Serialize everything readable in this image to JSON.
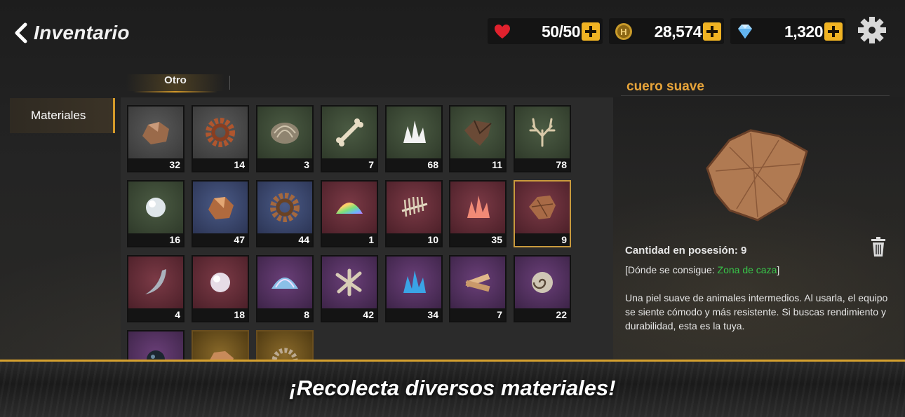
{
  "header": {
    "title": "Inventario",
    "resources": [
      {
        "name": "heart",
        "value": "50/50",
        "icon": "heart-icon"
      },
      {
        "name": "gold",
        "value": "28,574",
        "icon": "coin-icon"
      },
      {
        "name": "gems",
        "value": "1,320",
        "icon": "diamond-icon"
      }
    ]
  },
  "tabs": {
    "active": "Otro"
  },
  "sidebar": {
    "category": "Materiales"
  },
  "grid": {
    "items": [
      {
        "count": "32"
      },
      {
        "count": "14"
      },
      {
        "count": "3"
      },
      {
        "count": "7"
      },
      {
        "count": "68"
      },
      {
        "count": "11"
      },
      {
        "count": "78"
      },
      {
        "count": "16"
      },
      {
        "count": "47"
      },
      {
        "count": "44"
      },
      {
        "count": "1"
      },
      {
        "count": "10"
      },
      {
        "count": "35"
      },
      {
        "count": "9"
      },
      {
        "count": "4"
      },
      {
        "count": "18"
      },
      {
        "count": "8"
      },
      {
        "count": "42"
      },
      {
        "count": "34"
      },
      {
        "count": "7"
      },
      {
        "count": "22"
      },
      {
        "count": ""
      },
      {
        "count": ""
      },
      {
        "count": ""
      }
    ]
  },
  "details": {
    "name": "cuero suave",
    "quantity_label": "Cantidad en posesión: 9",
    "where_prefix": "[Dónde se consigue: ",
    "where_zone": "Zona de caza",
    "where_suffix": "]",
    "description": "Una piel suave de animales intermedios. Al usarla, el equipo se siente cómodo y más resistente. Si buscas rendimiento y durabilidad, esta es la tuya."
  },
  "banner": {
    "text": "¡Recolecta diversos materiales!"
  },
  "colors": {
    "accent": "#d49a2a",
    "title_orange": "#e7a43a",
    "zone_green": "#38c64a",
    "plus_yellow": "#f0b323"
  }
}
